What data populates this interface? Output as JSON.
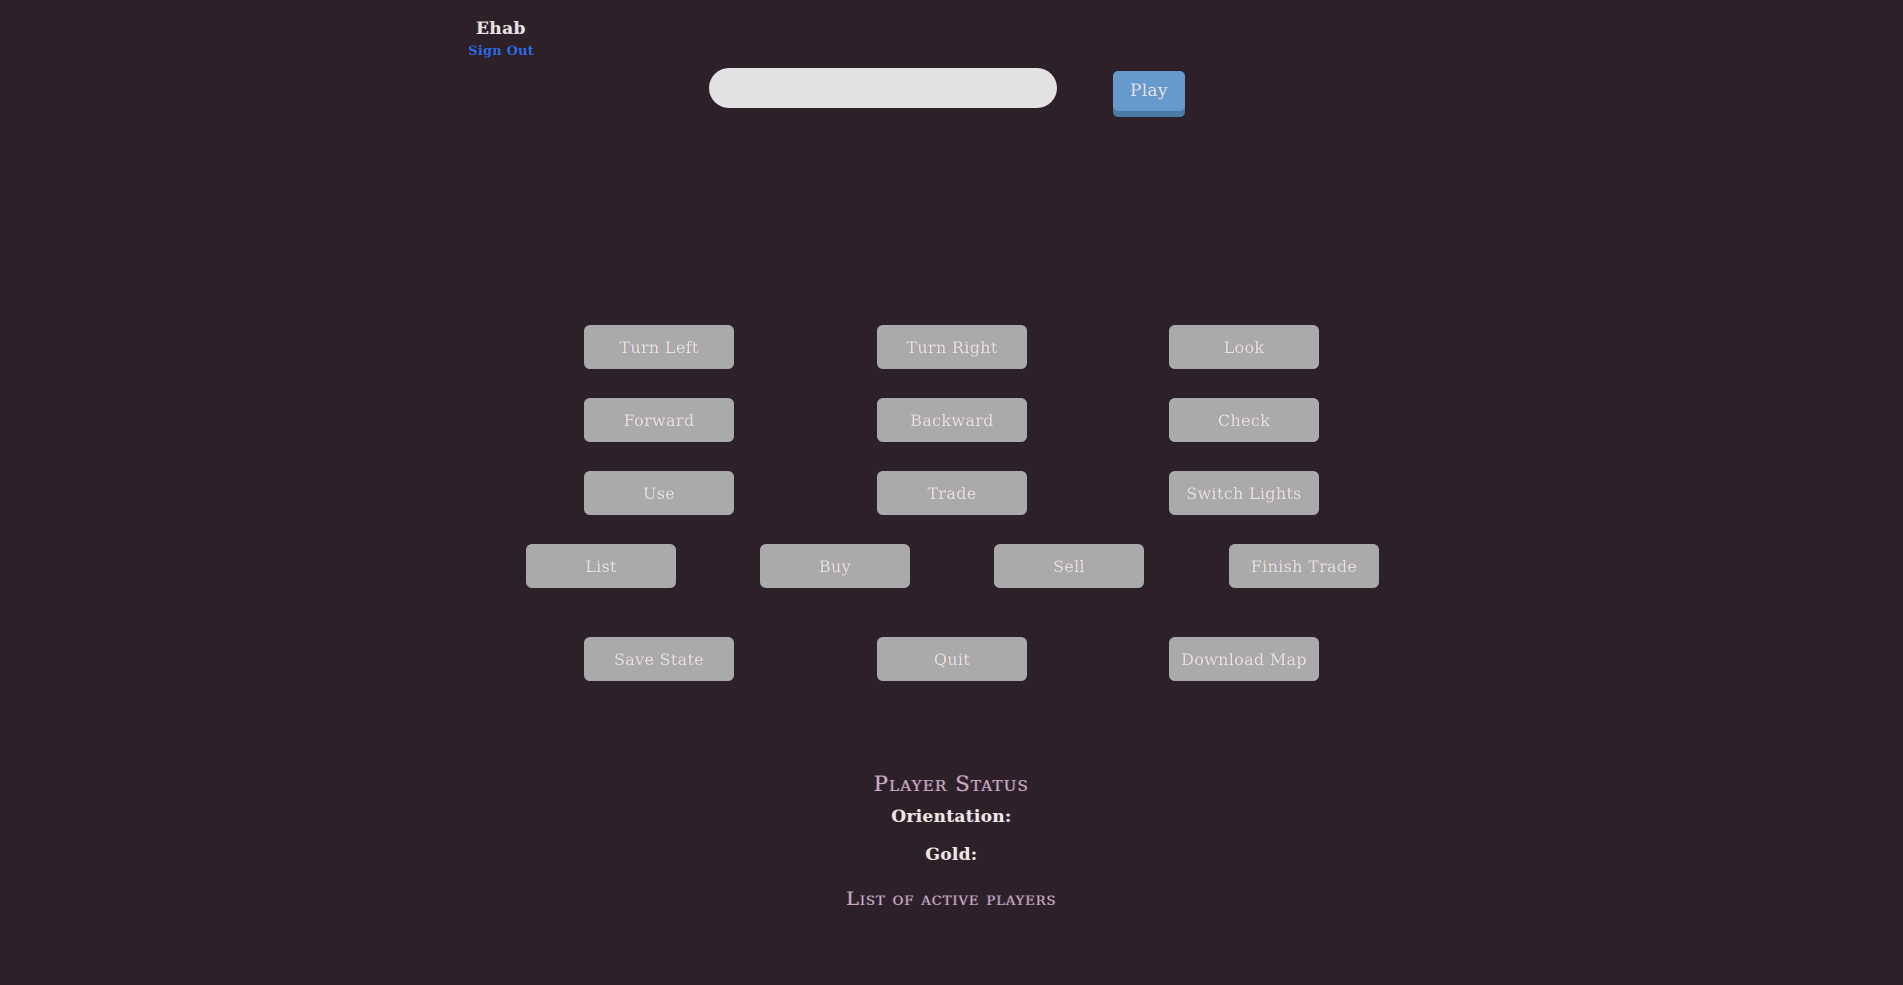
{
  "header": {
    "username": "Ehab",
    "sign_out_label": "Sign Out"
  },
  "command_bar": {
    "input_value": "",
    "input_placeholder": "",
    "play_label": "Play"
  },
  "actions": {
    "rows": [
      {
        "col1": "Turn Left",
        "col2": "Turn Right",
        "col3": "Look"
      },
      {
        "col1": "Forward",
        "col2": "Backward",
        "col3": "Check"
      },
      {
        "col1": "Use",
        "col2": "Trade",
        "col3": "Switch Lights"
      }
    ],
    "trade_row": [
      "List",
      "Buy",
      "Sell",
      "Finish Trade"
    ],
    "system_row": [
      "Save State",
      "Quit",
      "Download Map"
    ]
  },
  "status": {
    "heading": "Player Status",
    "orientation_label": "Orientation:",
    "orientation_value": "",
    "gold_label": "Gold:",
    "gold_value": "",
    "active_players_heading": "List of active players",
    "active_players": ""
  },
  "colors": {
    "background": "#2e2029",
    "button_gray": "#aaaaaa",
    "play_blue": "#6699cc",
    "play_blue_shadow": "#4a7aa8",
    "link_blue": "#2a6ae6",
    "heading_mauve": "#c9a9bb",
    "text_cream": "#eee7dc",
    "input_gray": "#e2e2e2"
  }
}
